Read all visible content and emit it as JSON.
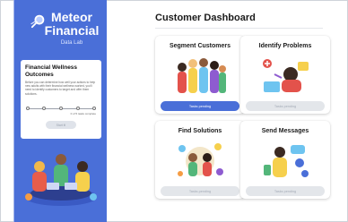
{
  "sidebar": {
    "brand": {
      "title_line1": "Meteor",
      "title_line2": "Financial",
      "subtitle": "Data Lab"
    },
    "card": {
      "title": "Financial Wellness Outcomes",
      "description": "Before you can determine how well your actions to help new adults with their financial wellness worked, you'll need to identify customers to target and offer them solutions.",
      "progress_label": "0 of 5 tasks complete",
      "button_label": "Start it!"
    }
  },
  "main": {
    "title": "Customer Dashboard",
    "tiles": [
      {
        "title": "Segment Customers",
        "button_label": "Tasks pending",
        "button_state": "active"
      },
      {
        "title": "Identify Problems",
        "button_label": "Tasks pending",
        "button_state": "disabled"
      },
      {
        "title": "Find Solutions",
        "button_label": "Tasks pending",
        "button_state": "disabled"
      },
      {
        "title": "Send Messages",
        "button_label": "Tasks pending",
        "button_state": "disabled"
      }
    ]
  },
  "colors": {
    "accent": "#4a6fd8",
    "disabled": "#e3e6ea"
  },
  "icons": [
    "comet-logo-icon",
    "people-group-illustration",
    "problem-solving-illustration",
    "ideas-illustration",
    "messaging-illustration",
    "team-meeting-illustration"
  ]
}
